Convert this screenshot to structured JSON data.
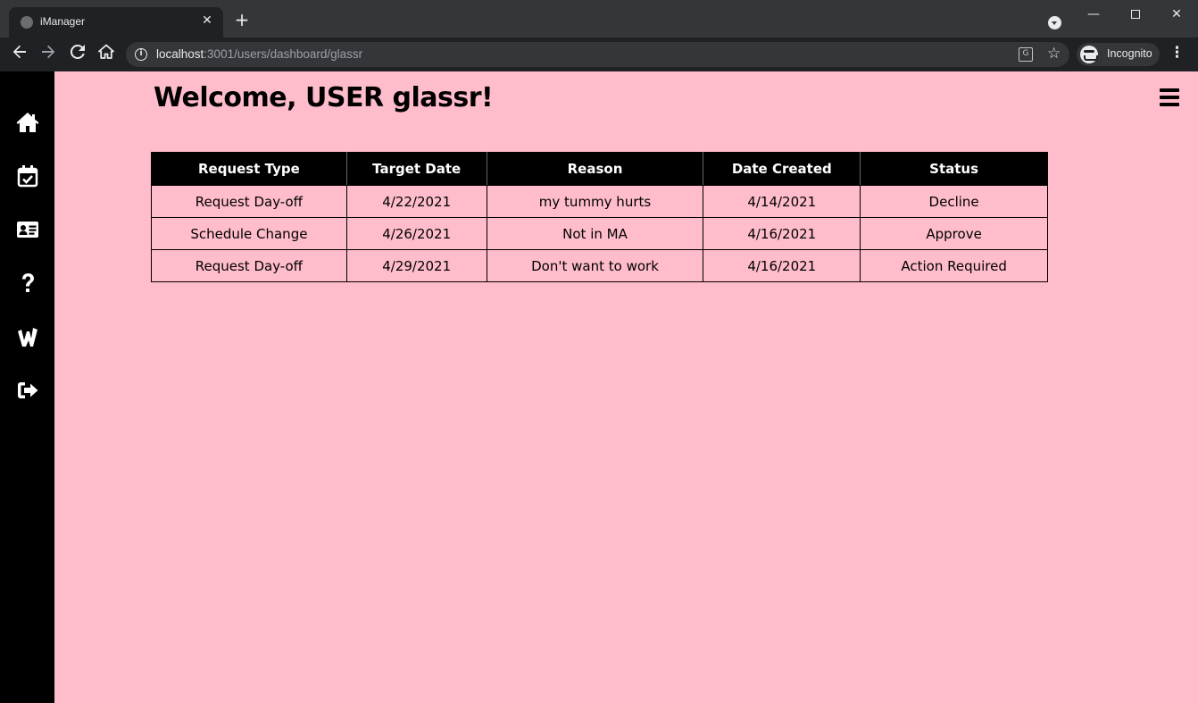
{
  "browser": {
    "tab_title": "iManager",
    "tab_close": "✕",
    "new_tab": "+",
    "url_host": "localhost",
    "url_path": ":3001/users/dashboard/glassr",
    "profile_label": "Incognito"
  },
  "sidebar": {
    "items": [
      {
        "name": "home-icon"
      },
      {
        "name": "calendar-check-icon"
      },
      {
        "name": "id-card-icon"
      },
      {
        "name": "question-icon"
      },
      {
        "name": "wingstop-logo-icon"
      },
      {
        "name": "sign-out-icon"
      }
    ]
  },
  "page": {
    "title": "Welcome, USER glassr!"
  },
  "table": {
    "headers": [
      "Request Type",
      "Target Date",
      "Reason",
      "Date Created",
      "Status"
    ],
    "rows": [
      {
        "request_type": "Request Day-off",
        "target_date": "4/22/2021",
        "reason": "my tummy hurts",
        "date_created": "4/14/2021",
        "status": "Decline"
      },
      {
        "request_type": "Schedule Change",
        "target_date": "4/26/2021",
        "reason": "Not in MA",
        "date_created": "4/16/2021",
        "status": "Approve"
      },
      {
        "request_type": "Request Day-off",
        "target_date": "4/29/2021",
        "reason": "Don't want to work",
        "date_created": "4/16/2021",
        "status": "Action Required"
      }
    ]
  },
  "colors": {
    "page_background": "#ffbccb",
    "sidebar_background": "#000000",
    "status_decline": "#f0001c",
    "status_approve": "#2fb82f",
    "status_action_required": "#808080"
  }
}
